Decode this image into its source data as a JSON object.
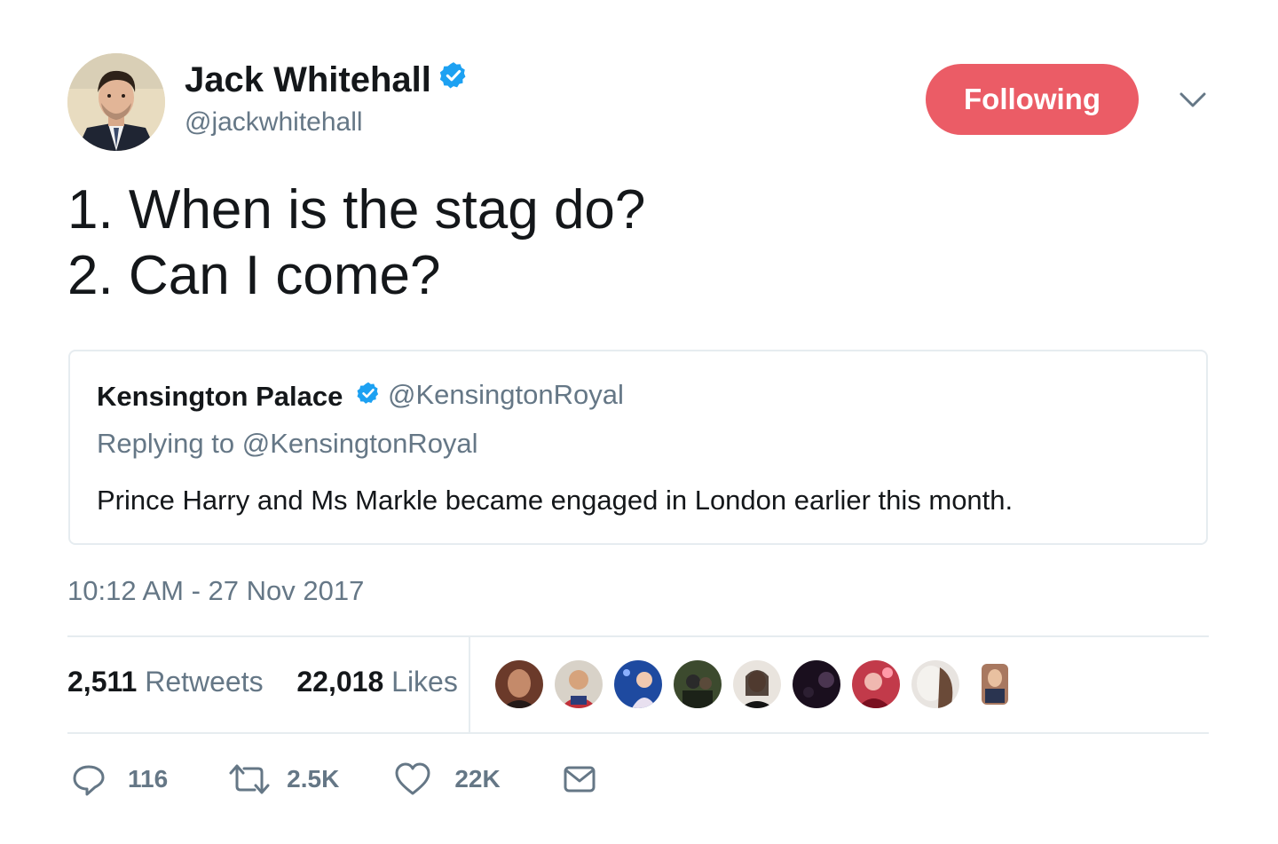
{
  "author": {
    "name": "Jack Whitehall",
    "handle": "@jackwhitehall",
    "verified": true
  },
  "follow_button": {
    "label": "Following",
    "color": "#eb5c66"
  },
  "tweet": {
    "text": "1. When is the stag do?\n2. Can I come?"
  },
  "quoted_tweet": {
    "name": "Kensington Palace",
    "handle": "@KensingtonRoyal",
    "replying_prefix": "Replying to ",
    "replying_to": "@KensingtonRoyal",
    "text": "Prince Harry and Ms Markle became engaged in London earlier this month."
  },
  "timestamp": "10:12 AM - 27 Nov 2017",
  "stats": {
    "retweets_count": "2,511",
    "retweets_label": "Retweets",
    "likes_count": "22,018",
    "likes_label": "Likes"
  },
  "actions": {
    "reply_count": "116",
    "retweet_count": "2.5K",
    "like_count": "22K"
  },
  "colors": {
    "verified_blue": "#1da1f2",
    "secondary_text": "#657786",
    "divider": "#e6ecf0"
  }
}
